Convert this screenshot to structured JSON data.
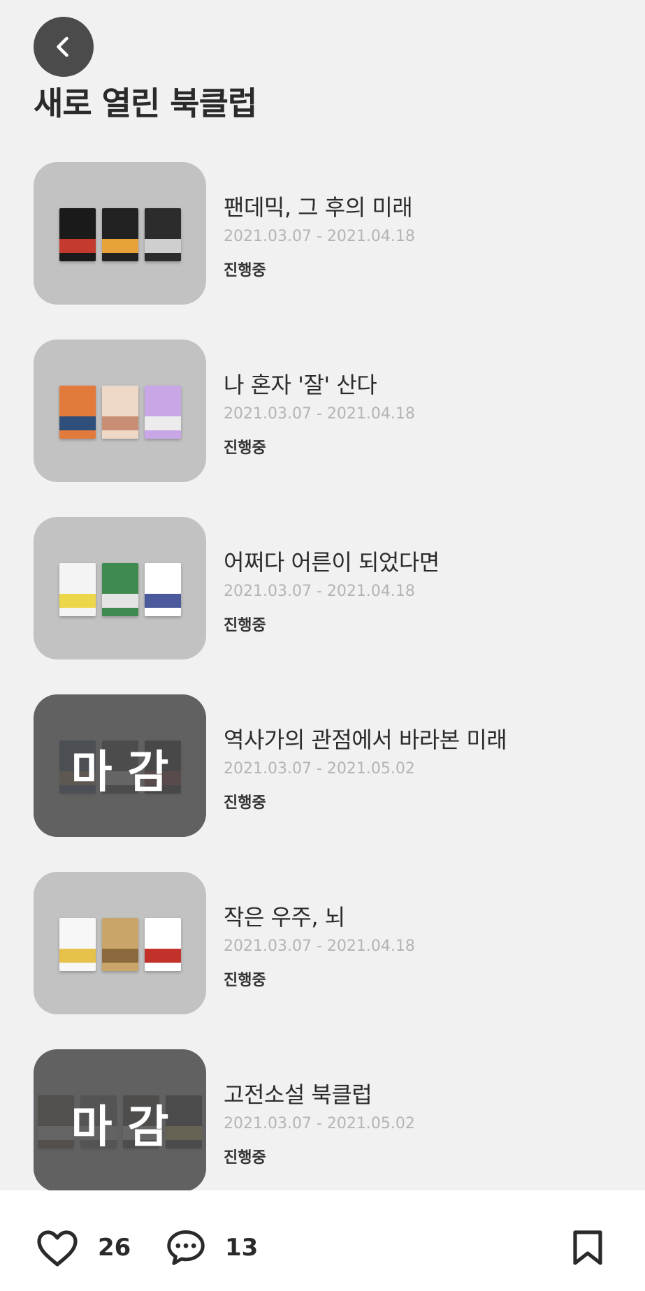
{
  "header": {
    "title": "새로 열린 북클럽"
  },
  "clubs": [
    {
      "title": "팬데믹, 그 후의 미래",
      "dates": "2021.03.07 - 2021.04.18",
      "status": "진행중",
      "closed": false,
      "book_colors": [
        [
          "#1a1a1a",
          "#c43a2e"
        ],
        [
          "#222222",
          "#e8a23a"
        ],
        [
          "#2c2c2c",
          "#cfcfcf"
        ]
      ]
    },
    {
      "title": "나 혼자 '잘' 산다",
      "dates": "2021.03.07 - 2021.04.18",
      "status": "진행중",
      "closed": false,
      "book_colors": [
        [
          "#e27a3c",
          "#2e4f7a"
        ],
        [
          "#f0d8c6",
          "#c98f74"
        ],
        [
          "#c9a7e6",
          "#ececec"
        ]
      ]
    },
    {
      "title": "어쩌다 어른이 되었다면",
      "dates": "2021.03.07 - 2021.04.18",
      "status": "진행중",
      "closed": false,
      "book_colors": [
        [
          "#f4f4f4",
          "#ecd64a"
        ],
        [
          "#3f8a4e",
          "#e4e4e4"
        ],
        [
          "#ffffff",
          "#4a5a9c"
        ]
      ]
    },
    {
      "title": "역사가의 관점에서 바라본 미래",
      "dates": "2021.03.07 - 2021.05.02",
      "status": "진행중",
      "closed": true,
      "closed_label": "마감",
      "book_colors": [
        [
          "#355070",
          "#b08960"
        ],
        [
          "#3b3b3b",
          "#d9d9d9"
        ],
        [
          "#1d1d1d",
          "#8c2f2f"
        ]
      ]
    },
    {
      "title": "작은 우주, 뇌",
      "dates": "2021.03.07 - 2021.04.18",
      "status": "진행중",
      "closed": false,
      "book_colors": [
        [
          "#f7f7f7",
          "#e6c24a"
        ],
        [
          "#caa56a",
          "#8a6a3c"
        ],
        [
          "#ffffff",
          "#c2322b"
        ]
      ]
    },
    {
      "title": "고전소설 북클럽",
      "dates": "2021.03.07 - 2021.05.02",
      "status": "진행중",
      "closed": true,
      "closed_label": "마감",
      "book_colors": [
        [
          "#5c4a3a",
          "#d8d8d8"
        ],
        [
          "#6a6a6a",
          "#d0d0d0"
        ],
        [
          "#4a3c30",
          "#e0e0e0"
        ],
        [
          "#303030",
          "#e6cf6a"
        ]
      ]
    }
  ],
  "footer": {
    "like_count": "26",
    "comment_count": "13"
  },
  "icons": {
    "back": "chevron-left-icon",
    "like": "heart-icon",
    "comment": "speech-bubble-icon",
    "bookmark": "bookmark-icon"
  }
}
